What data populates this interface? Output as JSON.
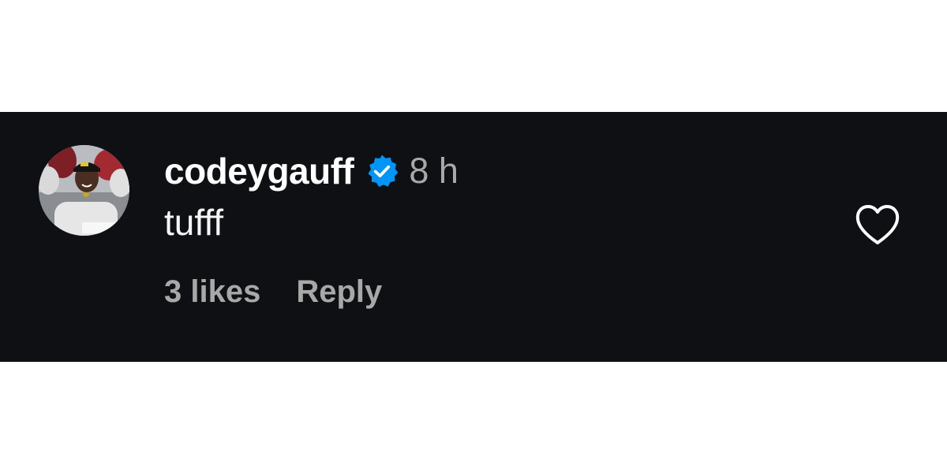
{
  "comment": {
    "username": "codeygauff",
    "verified_icon": "verified-badge-icon",
    "timestamp": "8 h",
    "text": "tufff",
    "likes_label": "3 likes",
    "reply_label": "Reply",
    "like_icon": "heart-outline-icon"
  },
  "colors": {
    "background": "#0e1013",
    "username": "#ffffff",
    "muted_text": "#a8a8a8",
    "verified_badge": "#0095f6"
  }
}
